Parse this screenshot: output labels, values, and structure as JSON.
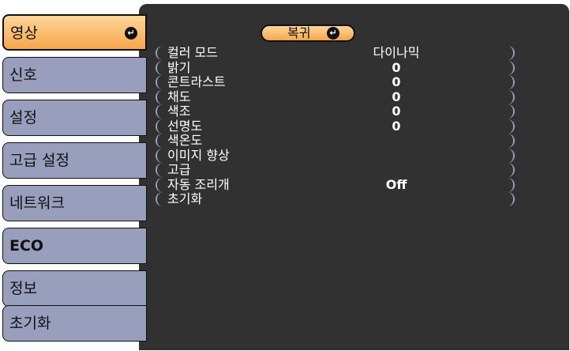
{
  "sidebar": {
    "tabs": [
      {
        "label": "영상"
      },
      {
        "label": "신호"
      },
      {
        "label": "설정"
      },
      {
        "label": "고급 설정"
      },
      {
        "label": "네트워크"
      },
      {
        "label": "ECO"
      },
      {
        "label": "정보"
      },
      {
        "label": "초기화"
      }
    ],
    "active_index": 0
  },
  "back_button": {
    "label": "복귀"
  },
  "enter_icon_glyph": "↵",
  "menu": {
    "items": [
      {
        "label": "컬러 모드",
        "value": "다이나믹"
      },
      {
        "label": "밝기",
        "value": "0"
      },
      {
        "label": "콘트라스트",
        "value": "0"
      },
      {
        "label": "채도",
        "value": "0"
      },
      {
        "label": "색조",
        "value": "0"
      },
      {
        "label": "선명도",
        "value": "0"
      },
      {
        "label": "색온도",
        "value": ""
      },
      {
        "label": "이미지 향상",
        "value": ""
      },
      {
        "label": "고급",
        "value": ""
      },
      {
        "label": "자동 조리개",
        "value": "Off"
      },
      {
        "label": "초기화",
        "value": ""
      }
    ]
  },
  "colors": {
    "panel_bg": "#313131",
    "tab_bg": "#9a9ebd",
    "highlight_top": "#ffd59a",
    "highlight_bottom": "#f6a64a",
    "text_light": "#ffffff"
  }
}
